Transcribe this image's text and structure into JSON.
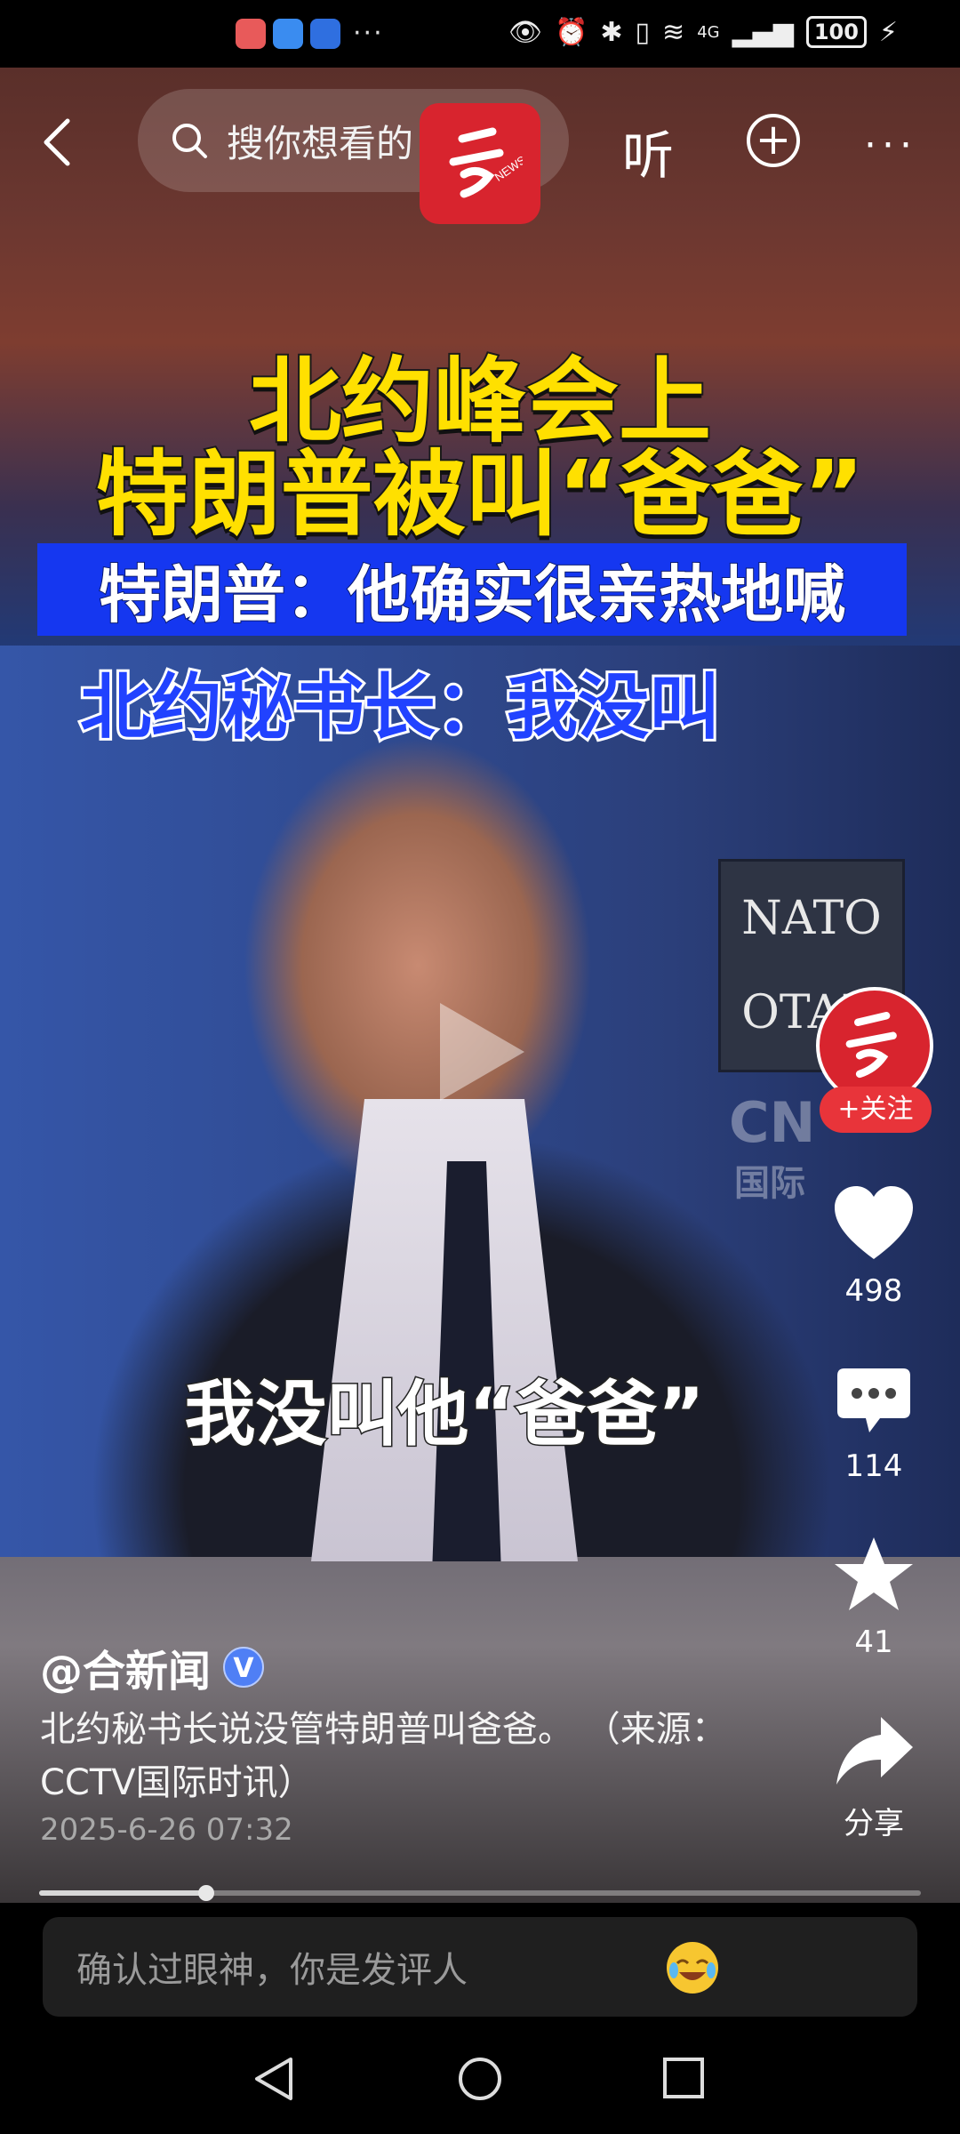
{
  "status_bar": {
    "more": "···",
    "battery": "100",
    "network": "4G"
  },
  "top_bar": {
    "search_placeholder": "搜你想看的",
    "listen_label": "听",
    "more_label": "···"
  },
  "video": {
    "headline_line1": "北约峰会上",
    "headline_line2": "特朗普被叫“爸爸”",
    "band_text": "特朗普：他确实很亲热地喊",
    "nato_line": "北约秘书长：我没叫",
    "subtitle": "我没叫他“爸爸”",
    "sign_line1": "NATO",
    "sign_line2": "OTAN",
    "watermark_line1": "CN",
    "watermark_line2": "国际",
    "progress": 0.19
  },
  "actions": {
    "follow_label": "+关注",
    "likes": "498",
    "comments": "114",
    "favorites": "41",
    "share_label": "分享"
  },
  "post": {
    "author": "@合新闻",
    "verified_mark": "V",
    "description": "北约秘书长说没管特朗普叫爸爸。 （来源：CCTV国际时讯）",
    "timestamp": "2025-6-26 07:32"
  },
  "comment_bar": {
    "placeholder": "确认过眼神，你是发评人"
  },
  "colors": {
    "brand_red": "#d8242e",
    "headline_yellow": "#ffe000",
    "band_blue": "#1537f0",
    "verified_blue": "#4f7ff5"
  }
}
